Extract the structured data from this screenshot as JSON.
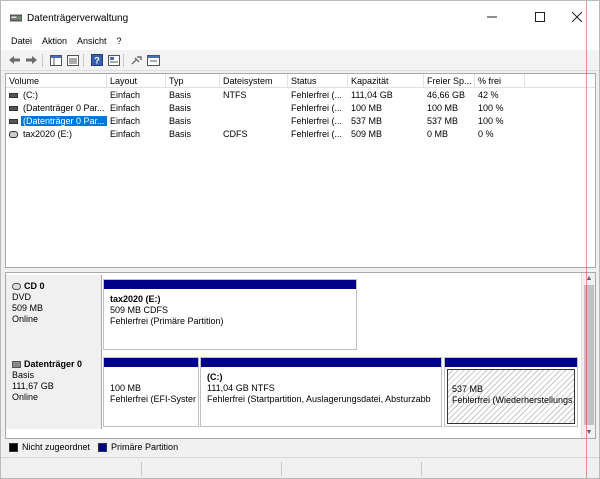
{
  "window": {
    "title": "Datenträgerverwaltung"
  },
  "menu": [
    "Datei",
    "Aktion",
    "Ansicht",
    "?"
  ],
  "list": {
    "columns": [
      "Volume",
      "Layout",
      "Typ",
      "Dateisystem",
      "Status",
      "Kapazität",
      "Freier Sp...",
      "% frei"
    ],
    "rows": [
      {
        "icon": "disk",
        "cells": [
          "(C:)",
          "Einfach",
          "Basis",
          "NTFS",
          "Fehlerfrei (...",
          "111,04 GB",
          "46,66 GB",
          "42 %"
        ]
      },
      {
        "icon": "disk",
        "cells": [
          "(Datenträger 0 Par...",
          "Einfach",
          "Basis",
          "",
          "Fehlerfrei (...",
          "100 MB",
          "100 MB",
          "100 %"
        ]
      },
      {
        "icon": "disk",
        "selected": true,
        "cells": [
          "(Datenträger 0 Par...",
          "Einfach",
          "Basis",
          "",
          "Fehlerfrei (...",
          "537 MB",
          "537 MB",
          "100 %"
        ]
      },
      {
        "icon": "cd",
        "cells": [
          "tax2020 (E:)",
          "Einfach",
          "Basis",
          "CDFS",
          "Fehlerfrei (...",
          "509 MB",
          "0 MB",
          "0 %"
        ]
      }
    ]
  },
  "disks": {
    "cd0": {
      "name": "CD 0",
      "type": "DVD",
      "size": "509 MB",
      "state": "Online",
      "partitions": [
        {
          "title": "tax2020  (E:)",
          "line2": "509 MB CDFS",
          "line3": "Fehlerfrei (Primäre Partition)"
        }
      ]
    },
    "disk0": {
      "name": "Datenträger 0",
      "type": "Basis",
      "size": "111,67 GB",
      "state": "Online",
      "partitions": [
        {
          "title": "",
          "line2": "100 MB",
          "line3": "Fehlerfrei (EFI-Systen"
        },
        {
          "title": "(C:)",
          "line2": "111,04 GB NTFS",
          "line3": "Fehlerfrei (Startpartition, Auslagerungsdatei, Absturzabb"
        },
        {
          "title": "",
          "line2": "537 MB",
          "line3": "Fehlerfrei (Wiederherstellungs"
        }
      ]
    }
  },
  "legend": [
    {
      "label": "Nicht zugeordnet",
      "color": "#000000"
    },
    {
      "label": "Primäre Partition",
      "color": "#00008b"
    }
  ]
}
